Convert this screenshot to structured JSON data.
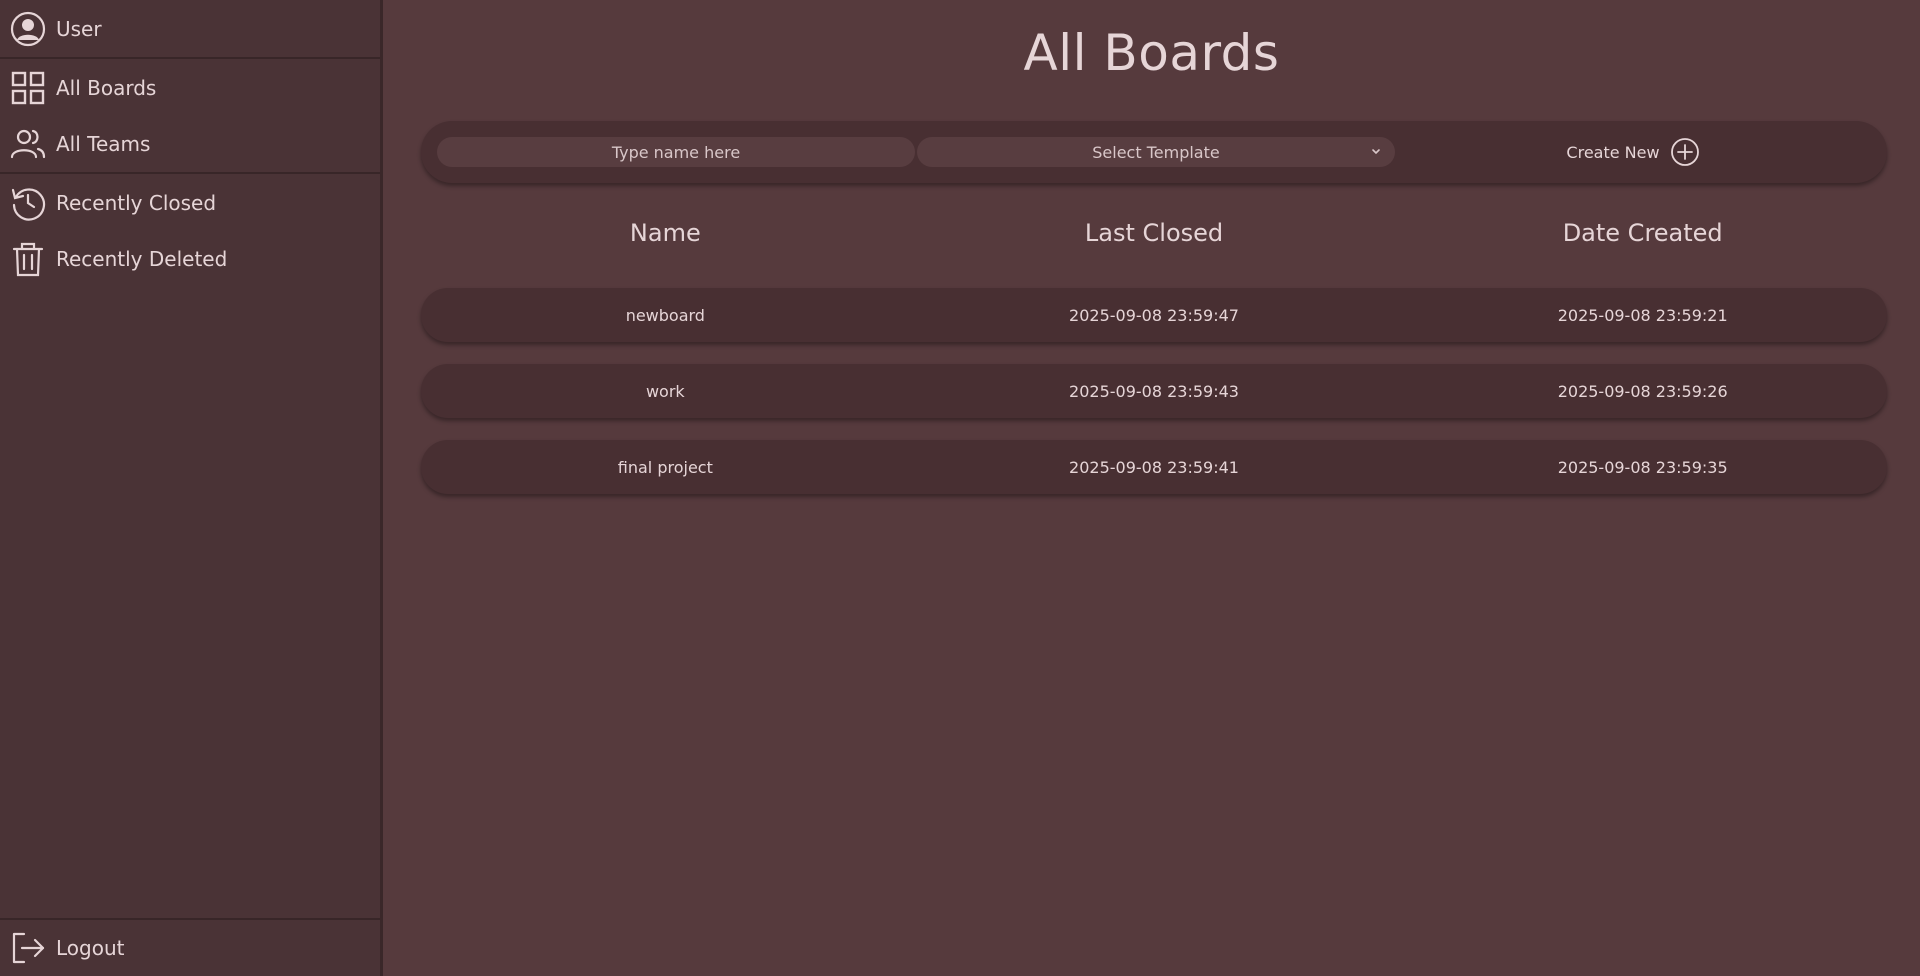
{
  "sidebar": {
    "user_label": "User",
    "items": [
      {
        "label": "All Boards"
      },
      {
        "label": "All Teams"
      },
      {
        "label": "Recently Closed"
      },
      {
        "label": "Recently Deleted"
      }
    ],
    "logout_label": "Logout"
  },
  "main": {
    "title": "All Boards",
    "toolbar": {
      "name_placeholder": "Type name here",
      "template_select_label": "Select Template",
      "create_new_label": "Create New"
    },
    "columns": [
      "Name",
      "Last Closed",
      "Date Created"
    ],
    "boards": [
      {
        "name": "newboard",
        "last_closed": "2025-09-08 23:59:47",
        "date_created": "2025-09-08 23:59:21"
      },
      {
        "name": "work",
        "last_closed": "2025-09-08 23:59:43",
        "date_created": "2025-09-08 23:59:26"
      },
      {
        "name": "final project",
        "last_closed": "2025-09-08 23:59:41",
        "date_created": "2025-09-08 23:59:35"
      }
    ]
  },
  "icons": {
    "user": "user-circle-icon",
    "boards": "grid-icon",
    "teams": "users-icon",
    "closed": "history-icon",
    "deleted": "trash-icon",
    "logout": "logout-icon",
    "chevron": "chevron-down-icon",
    "create": "plus-circle-icon"
  },
  "colors": {
    "background": "#563a3d",
    "sidebar": "#4a3336",
    "card": "#482f32",
    "text": "#e6d5d7"
  }
}
